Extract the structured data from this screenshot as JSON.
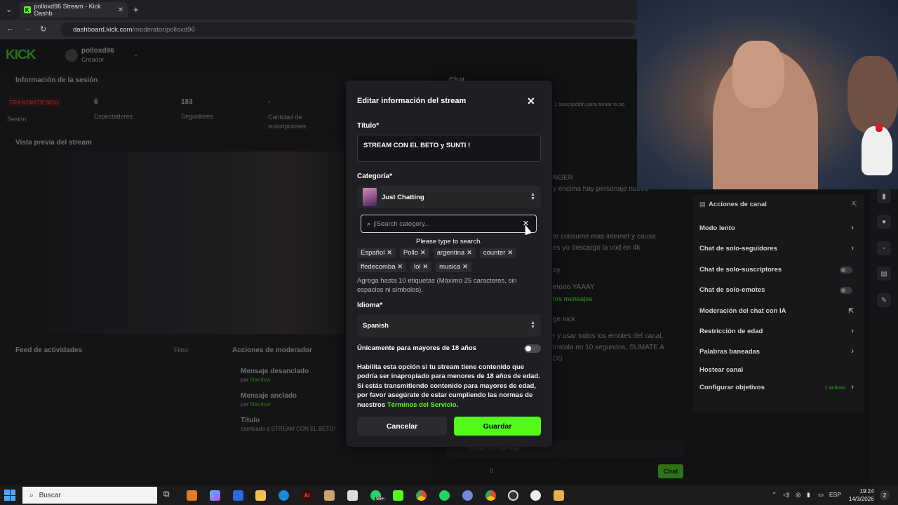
{
  "browser": {
    "tab_title": "polloxd96 Stream - Kick Dashb",
    "tab_close": "✕",
    "new_tab": "+",
    "url_host": "dashboard.kick.com",
    "url_path": "/moderator/polloxd96"
  },
  "dashboard": {
    "logo": "KICK",
    "user_name": "polloxd96",
    "user_role": "Creador",
    "session_section": "Información de la sesión",
    "live_badge": "TRANSMITIENDO",
    "session_label": "Sesión",
    "viewers_value": "6",
    "viewers_label": "Espectadores",
    "followers_value": "183",
    "followers_label": "Seguidores",
    "subs_value": "-",
    "subs_label": "Cantidad de suscripciones",
    "preview_section": "Vista previa del stream",
    "chat_section": "Chat",
    "chat_subnote": "1 suscripción para tomar la po",
    "activity_feed": "Feed de actividades",
    "filter_label": "Filtro",
    "mod_actions": "Acciones de moderador",
    "mod_items": [
      {
        "title": "Mensaje desanclado",
        "by": "por",
        "user": "Nanitow"
      },
      {
        "title": "Mensaje anclado",
        "by": "por",
        "user": "Nanitow"
      },
      {
        "title": "Título",
        "by": "cambiado a",
        "user": "STREAM CON EL BETO!"
      }
    ],
    "chat_lines": [
      "NGER",
      "y encima hay personaje nuevo",
      "te consume mas internet y causa",
      "es yo descargo la vod en 4k",
      "oy",
      "etooo YAAAY",
      "los mensajes",
      "ge nick",
      "r y usar todos los emotes del canal,",
      "Instala en 10 segundos, SUMATE A",
      "DS"
    ],
    "chat_input_placeholder": "Enviar un mensaje",
    "chat_count": "0",
    "chat_button": "Chat"
  },
  "channel_actions": {
    "title": "Acciones de canal",
    "items": [
      {
        "label": "Modo lento",
        "control": "arrow"
      },
      {
        "label": "Chat de solo-seguidores",
        "control": "arrow"
      },
      {
        "label": "Chat de solo-suscriptores",
        "control": "toggle"
      },
      {
        "label": "Chat de solo-emotes",
        "control": "toggle"
      },
      {
        "label": "Moderación del chat con IA",
        "control": "external"
      },
      {
        "label": "Restricción de edad",
        "control": "arrow"
      },
      {
        "label": "Palabras baneadas",
        "control": "arrow"
      },
      {
        "label": "Hostear canal",
        "control": "none"
      },
      {
        "label": "Configurar objetivos",
        "control": "arrow"
      }
    ],
    "goals_active": "1 activas"
  },
  "modal": {
    "title": "Editar información del stream",
    "title_label": "Título*",
    "title_value": "STREAM CON EL BETO y SUNTI !",
    "category_label": "Categoría*",
    "category_value": "Just Chatting",
    "search_placeholder": "Search category...",
    "search_hint": "Please type to search.",
    "tags": [
      "Español",
      "Pollo",
      "argentina",
      "counter",
      "ffedecomba",
      "lol",
      "musica"
    ],
    "tag_remove": "✕",
    "tags_note": "Agrega hasta 10 etiquetas (Máximo 25 caracteres, sin espacios ni símbolos).",
    "language_label": "Idioma*",
    "language_value": "Spanish",
    "adult_label": "Únicamente para mayores de 18 años",
    "adult_enabled": false,
    "warning_text": "Habilita esta opción si tu stream tiene contenido que podría ser inapropiado para menores de 18 años de edad. Si estás transmitiendo contenido para mayores de edad, por favor asegúrate de estar cumpliendo las normas de nuestros ",
    "terms_link": "Términos del Servicio",
    "warning_end": ".",
    "cancel_label": "Cancelar",
    "save_label": "Guardar"
  },
  "taskbar": {
    "search_label": "Buscar",
    "badge": "99+",
    "lang": "ESP",
    "time": "19:24",
    "date": "14/3/2026",
    "notif_count": "2"
  },
  "colors": {
    "accent": "#53fc18",
    "modal_bg": "#1e1f22",
    "live_red": "#ff3b3b"
  }
}
